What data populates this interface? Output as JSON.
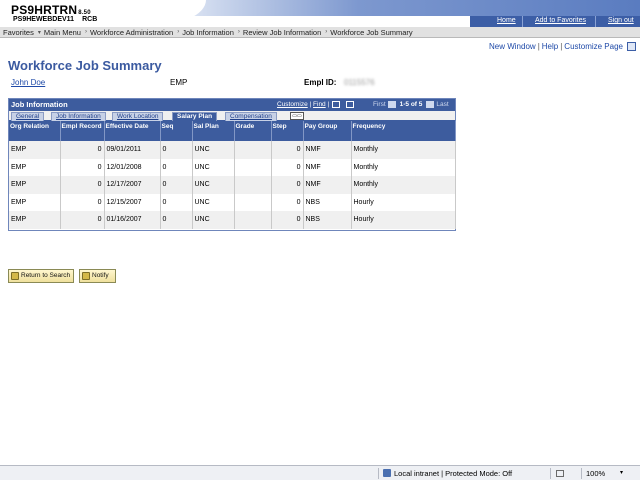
{
  "header": {
    "system_name": "PS9HRTRN",
    "version": "8.50",
    "database": "PS9HEWEBDEV11",
    "user_code": "RCB",
    "links": {
      "home": "Home",
      "favorites": "Add to Favorites",
      "signout": "Sign out"
    }
  },
  "nav": {
    "breadcrumbs": [
      "Favorites",
      "Main Menu",
      "Workforce Administration",
      "Job Information",
      "Review Job Information",
      "Workforce Job Summary"
    ]
  },
  "page_links": {
    "new_window": "New Window",
    "help": "Help",
    "customize_page": "Customize Page"
  },
  "page": {
    "title": "Workforce Job Summary",
    "employee_name": "John Doe",
    "employee_type": "EMP",
    "emplid_label": "Empl ID:",
    "emplid_value": "0115576"
  },
  "grid": {
    "title": "Job Information",
    "customize": "Customize",
    "find": "Find",
    "first": "First",
    "count": "1-5 of 5",
    "last": "Last",
    "tabs": [
      "General",
      "Job Information",
      "Work Location",
      "Salary Plan",
      "Compensation"
    ],
    "active_tab": "Salary Plan",
    "columns": [
      "Org Relation",
      "Empl Record",
      "Effective Date",
      "Seq",
      "Sal Plan",
      "Grade",
      "Step",
      "Pay Group",
      "Frequency"
    ],
    "rows": [
      [
        "EMP",
        "0",
        "09/01/2011",
        "0",
        "UNC",
        "",
        "0",
        "NMF",
        "Monthly"
      ],
      [
        "EMP",
        "0",
        "12/01/2008",
        "0",
        "UNC",
        "",
        "0",
        "NMF",
        "Monthly"
      ],
      [
        "EMP",
        "0",
        "12/17/2007",
        "0",
        "UNC",
        "",
        "0",
        "NMF",
        "Monthly"
      ],
      [
        "EMP",
        "0",
        "12/15/2007",
        "0",
        "UNC",
        "",
        "0",
        "NBS",
        "Hourly"
      ],
      [
        "EMP",
        "0",
        "01/16/2007",
        "0",
        "UNC",
        "",
        "0",
        "NBS",
        "Hourly"
      ]
    ]
  },
  "buttons": {
    "return_to_search": "Return to Search",
    "notify": "Notify"
  },
  "status_bar": {
    "zone": "Local intranet | Protected Mode: Off",
    "zoom": "100%"
  },
  "colors": {
    "accent": "#3d5c9e",
    "link": "#1f4aa8",
    "title": "#3b5aa0"
  }
}
